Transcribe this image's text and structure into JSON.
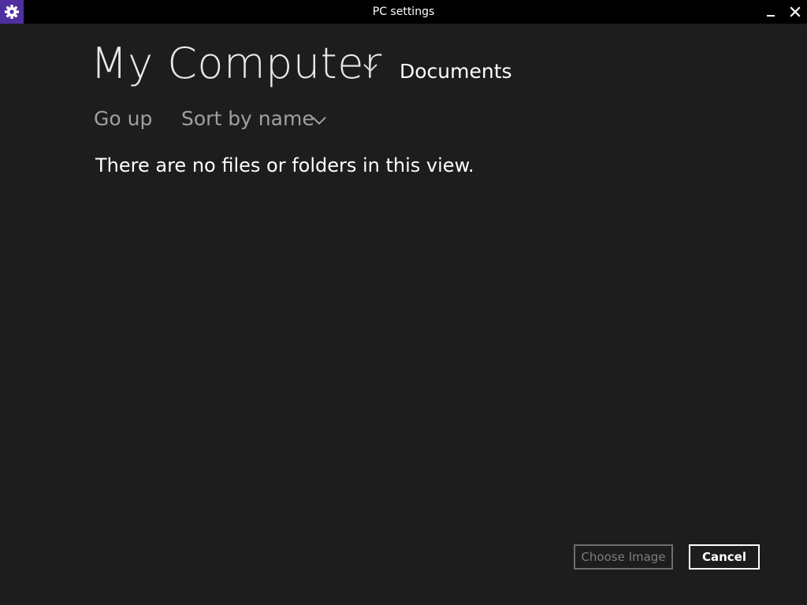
{
  "window": {
    "title": "PC settings",
    "app_icon": "gear-icon",
    "minimize_icon": "minimize-icon",
    "close_icon": "close-icon"
  },
  "location": {
    "title": "My Computer",
    "dropdown_icon": "chevron-down-icon",
    "subfolder": "Documents"
  },
  "commands": {
    "go_up": "Go up",
    "sort_label": "Sort by name",
    "sort_dropdown_icon": "chevron-down-icon"
  },
  "content": {
    "empty_message": "There are no files or folders in this view."
  },
  "buttons": {
    "choose_image": "Choose Image",
    "choose_image_enabled": false,
    "cancel": "Cancel"
  },
  "colors": {
    "background": "#1d1d1d",
    "titlebar": "#000000",
    "accent": "#4f2fa0",
    "text": "#ffffff",
    "muted_text": "#a0a0a0",
    "disabled": "#7c7c7c"
  }
}
